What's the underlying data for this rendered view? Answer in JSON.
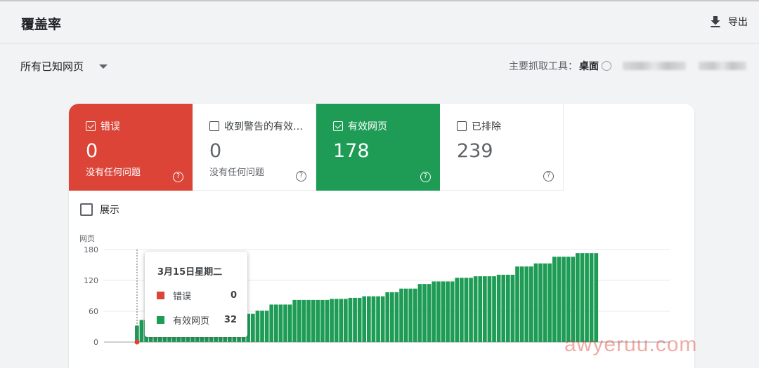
{
  "header": {
    "title": "覆盖率",
    "export_label": "导出"
  },
  "filter": {
    "page_filter": "所有已知网页",
    "crawler_label": "主要抓取工具：",
    "crawler_value": "桌面"
  },
  "tiles": [
    {
      "label": "错误",
      "value": "0",
      "sub": "没有任何问题",
      "checked": true,
      "color": "#db4437"
    },
    {
      "label": "收到警告的有效…",
      "value": "0",
      "sub": "没有任何问题",
      "checked": false,
      "color": "#ffffff"
    },
    {
      "label": "有效网页",
      "value": "178",
      "sub": "",
      "checked": true,
      "color": "#1e9c56"
    },
    {
      "label": "已排除",
      "value": "239",
      "sub": "",
      "checked": false,
      "color": "#ffffff"
    }
  ],
  "impressions_label": "展示",
  "tooltip": {
    "date": "3月15日星期二",
    "rows": [
      {
        "label": "错误",
        "value": "0",
        "color": "#db4437"
      },
      {
        "label": "有效网页",
        "value": "32",
        "color": "#1e9c56"
      }
    ]
  },
  "watermark": "awyeruu.com",
  "chart_data": {
    "type": "bar",
    "ylabel": "网页",
    "yticks": [
      0,
      60,
      120,
      180
    ],
    "ylim": [
      0,
      180
    ],
    "grid": true,
    "series": [
      {
        "name": "错误",
        "color": "#db4437",
        "values": [
          0
        ]
      },
      {
        "name": "有效网页",
        "color": "#1e9c56",
        "values": [
          32,
          43,
          43,
          43,
          43,
          43,
          43,
          43,
          43,
          43,
          43,
          43,
          43,
          43,
          43,
          49,
          49,
          49,
          53,
          53,
          53,
          55,
          55,
          55,
          55,
          55,
          61,
          61,
          61,
          73,
          73,
          73,
          73,
          73,
          82,
          82,
          82,
          82,
          82,
          82,
          82,
          82,
          84,
          84,
          84,
          84,
          86,
          86,
          86,
          89,
          89,
          89,
          89,
          89,
          97,
          97,
          97,
          104,
          104,
          104,
          104,
          113,
          113,
          113,
          118,
          118,
          118,
          118,
          118,
          125,
          125,
          125,
          125,
          128,
          128,
          128,
          128,
          128,
          131,
          131,
          131,
          131,
          147,
          147,
          147,
          147,
          153,
          153,
          153,
          153,
          166,
          166,
          166,
          166,
          166,
          173,
          173,
          173,
          173,
          173
        ]
      }
    ]
  }
}
